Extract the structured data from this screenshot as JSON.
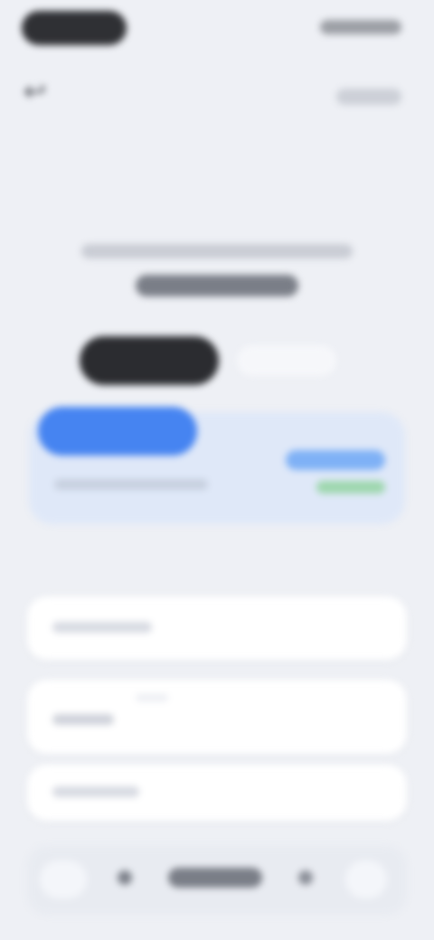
{
  "app": {
    "background": "#eef0f5"
  },
  "icons": {
    "back": "↩"
  },
  "colors": {
    "accent_blue": "#3d7ef0",
    "accent_green": "#9dd7ad",
    "dark_pill": "#2b2c30"
  }
}
